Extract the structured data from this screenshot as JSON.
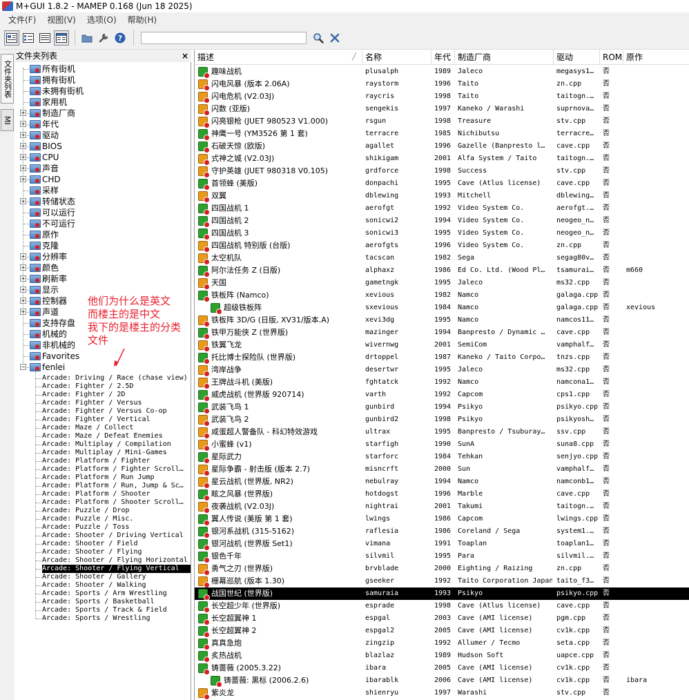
{
  "app": {
    "title": "M+GUI 1.8.2 - MAMEP 0.168 (Jun 18 2025)"
  },
  "menu": [
    "文件(F)",
    "视图(V)",
    "选项(O)",
    "帮助(H)"
  ],
  "search": {
    "value": "",
    "placeholder": ""
  },
  "vtabs": [
    "文件夹列表",
    "MI"
  ],
  "folder_panel": {
    "title": "文件夹列表",
    "close": "×"
  },
  "folders": [
    {
      "label": "所有街机",
      "exp": false
    },
    {
      "label": "拥有街机",
      "exp": false
    },
    {
      "label": "未拥有街机",
      "exp": false
    },
    {
      "label": "家用机",
      "exp": false
    },
    {
      "label": "制造厂商",
      "exp": true
    },
    {
      "label": "年代",
      "exp": true
    },
    {
      "label": "驱动",
      "exp": true
    },
    {
      "label": "BIOS",
      "exp": true
    },
    {
      "label": "CPU",
      "exp": true
    },
    {
      "label": "声音",
      "exp": true
    },
    {
      "label": "CHD",
      "exp": true
    },
    {
      "label": "采样",
      "exp": false
    },
    {
      "label": "转储状态",
      "exp": true
    },
    {
      "label": "可以运行",
      "exp": false
    },
    {
      "label": "不可运行",
      "exp": false
    },
    {
      "label": "原作",
      "exp": false
    },
    {
      "label": "克隆",
      "exp": false
    },
    {
      "label": "分辨率",
      "exp": true
    },
    {
      "label": "颜色",
      "exp": true
    },
    {
      "label": "刷新率",
      "exp": true
    },
    {
      "label": "显示",
      "exp": true
    },
    {
      "label": "控制器",
      "exp": true
    },
    {
      "label": "声道",
      "exp": true
    },
    {
      "label": "支持存盘",
      "exp": false
    },
    {
      "label": "机械的",
      "exp": false
    },
    {
      "label": "非机械的",
      "exp": false
    },
    {
      "label": "Favorites",
      "exp": false
    },
    {
      "label": "fenlei",
      "exp": "open"
    }
  ],
  "fenlei_items": [
    "Arcade: Driving / Race (chase view)",
    "Arcade: Fighter / 2.5D",
    "Arcade: Fighter / 2D",
    "Arcade: Fighter / Versus",
    "Arcade: Fighter / Versus Co-op",
    "Arcade: Fighter / Vertical",
    "Arcade: Maze / Collect",
    "Arcade: Maze / Defeat Enemies",
    "Arcade: Multiplay / Compilation",
    "Arcade: Multiplay / Mini-Games",
    "Arcade: Platform / Fighter",
    "Arcade: Platform / Fighter Scroll…",
    "Arcade: Platform / Run Jump",
    "Arcade: Platform / Run, Jump & Sc…",
    "Arcade: Platform / Shooter",
    "Arcade: Platform / Shooter Scroll…",
    "Arcade: Puzzle / Drop",
    "Arcade: Puzzle / Misc.",
    "Arcade: Puzzle / Toss",
    "Arcade: Shooter / Driving Vertical",
    "Arcade: Shooter / Field",
    "Arcade: Shooter / Flying",
    "Arcade: Shooter / Flying Horizontal",
    "Arcade: Shooter / Flying Vertical",
    "Arcade: Shooter / Gallery",
    "Arcade: Shooter / Walking",
    "Arcade: Sports / Arm Wrestling",
    "Arcade: Sports / Basketball",
    "Arcade: Sports / Track & Field",
    "Arcade: Sports / Wrestling"
  ],
  "selected_fenlei": 23,
  "annotation": [
    "他们为什么是英文",
    "而楼主的是中文",
    "我下的是楼主的分类",
    "文件"
  ],
  "columns": [
    "描述",
    "名称",
    "年代",
    "制造厂商",
    "驱动",
    "ROMs",
    "原作"
  ],
  "sort_indicator": "╱",
  "games": [
    {
      "d": "趣味战机",
      "n": "plusalph",
      "y": "1989",
      "m": "Jaleco",
      "dr": "megasys1…",
      "r": "否",
      "p": "",
      "i": "ok",
      "c": 0
    },
    {
      "d": "闪电风暴 (版本 2.06A)",
      "n": "raystorm",
      "y": "1996",
      "m": "Taito",
      "dr": "zn.cpp",
      "r": "否",
      "p": "",
      "i": "warn",
      "c": 0
    },
    {
      "d": "闪电危机 (V2.03J)",
      "n": "raycris",
      "y": "1998",
      "m": "Taito",
      "dr": "taitogn.…",
      "r": "否",
      "p": "",
      "i": "warn",
      "c": 0
    },
    {
      "d": "闪数 (亚版)",
      "n": "sengekis",
      "y": "1997",
      "m": "Kaneko / Warashi",
      "dr": "suprnova…",
      "r": "否",
      "p": "",
      "i": "warn",
      "c": 0
    },
    {
      "d": "闪亮银枪 (JUET 980523 V1.000)",
      "n": "rsgun",
      "y": "1998",
      "m": "Treasure",
      "dr": "stv.cpp",
      "r": "否",
      "p": "",
      "i": "warn",
      "c": 0
    },
    {
      "d": "神鹰一号 (YM3526 第 1 套)",
      "n": "terracre",
      "y": "1985",
      "m": "Nichibutsu",
      "dr": "terracre…",
      "r": "否",
      "p": "",
      "i": "ok",
      "c": 0
    },
    {
      "d": "石破天惊 (欧版)",
      "n": "agallet",
      "y": "1996",
      "m": "Gazelle (Banpresto l…",
      "dr": "cave.cpp",
      "r": "否",
      "p": "",
      "i": "ok",
      "c": 0
    },
    {
      "d": "式神之城 (V2.03J)",
      "n": "shikigam",
      "y": "2001",
      "m": "Alfa System / Taito",
      "dr": "taitogn.…",
      "r": "否",
      "p": "",
      "i": "warn",
      "c": 0
    },
    {
      "d": "守护英雄 (JUET 980318 V0.105)",
      "n": "grdforce",
      "y": "1998",
      "m": "Success",
      "dr": "stv.cpp",
      "r": "否",
      "p": "",
      "i": "warn",
      "c": 0
    },
    {
      "d": "首领蜂 (美版)",
      "n": "donpachi",
      "y": "1995",
      "m": "Cave (Atlus license)",
      "dr": "cave.cpp",
      "r": "否",
      "p": "",
      "i": "ok",
      "c": 0
    },
    {
      "d": "双翼",
      "n": "dblewing",
      "y": "1993",
      "m": "Mitchell",
      "dr": "dblewing…",
      "r": "否",
      "p": "",
      "i": "warn",
      "c": 0
    },
    {
      "d": "四国战机 1",
      "n": "aerofgt",
      "y": "1992",
      "m": "Video System Co.",
      "dr": "aerofgt.…",
      "r": "否",
      "p": "",
      "i": "ok",
      "c": 0
    },
    {
      "d": "四国战机 2",
      "n": "sonicwi2",
      "y": "1994",
      "m": "Video System Co.",
      "dr": "neogeo_n…",
      "r": "否",
      "p": "",
      "i": "ok",
      "c": 0
    },
    {
      "d": "四国战机 3",
      "n": "sonicwi3",
      "y": "1995",
      "m": "Video System Co.",
      "dr": "neogeo_n…",
      "r": "否",
      "p": "",
      "i": "ok",
      "c": 0
    },
    {
      "d": "四国战机 特别版 (台版)",
      "n": "aerofgts",
      "y": "1996",
      "m": "Video System Co.",
      "dr": "zn.cpp",
      "r": "否",
      "p": "",
      "i": "warn",
      "c": 0
    },
    {
      "d": "太空机队",
      "n": "tacscan",
      "y": "1982",
      "m": "Sega",
      "dr": "segag80v…",
      "r": "否",
      "p": "",
      "i": "warn",
      "c": 0
    },
    {
      "d": "阿尔法任务 Z (日版)",
      "n": "alphaxz",
      "y": "1986",
      "m": "Ed Co. Ltd. (Wood Pl…",
      "dr": "tsamurai…",
      "r": "否",
      "p": "m660",
      "i": "ok",
      "c": 0
    },
    {
      "d": "天国",
      "n": "gametngk",
      "y": "1995",
      "m": "Jaleco",
      "dr": "ms32.cpp",
      "r": "否",
      "p": "",
      "i": "warn",
      "c": 0
    },
    {
      "d": "铁板阵 (Namco)",
      "n": "xevious",
      "y": "1982",
      "m": "Namco",
      "dr": "galaga.cpp",
      "r": "否",
      "p": "",
      "i": "ok",
      "c": 0
    },
    {
      "d": "超级铁板阵",
      "n": "sxevious",
      "y": "1984",
      "m": "Namco",
      "dr": "galaga.cpp",
      "r": "否",
      "p": "xevious",
      "i": "ok",
      "c": 1
    },
    {
      "d": "铁板阵 3D/G (日版, XV31/版本.A)",
      "n": "xevi3dg",
      "y": "1995",
      "m": "Namco",
      "dr": "namcos11…",
      "r": "否",
      "p": "",
      "i": "warn",
      "c": 0
    },
    {
      "d": "铁甲万能侠 Z (世界版)",
      "n": "mazinger",
      "y": "1994",
      "m": "Banpresto / Dynamic …",
      "dr": "cave.cpp",
      "r": "否",
      "p": "",
      "i": "ok",
      "c": 0
    },
    {
      "d": "铁翼飞龙",
      "n": "wivernwg",
      "y": "2001",
      "m": "SemiCom",
      "dr": "vamphalf…",
      "r": "否",
      "p": "",
      "i": "warn",
      "c": 0
    },
    {
      "d": "托比博士探险队 (世界版)",
      "n": "drtoppel",
      "y": "1987",
      "m": "Kaneko / Taito Corpo…",
      "dr": "tnzs.cpp",
      "r": "否",
      "p": "",
      "i": "ok",
      "c": 0
    },
    {
      "d": "湾岸战争",
      "n": "desertwr",
      "y": "1995",
      "m": "Jaleco",
      "dr": "ms32.cpp",
      "r": "否",
      "p": "",
      "i": "warn",
      "c": 0
    },
    {
      "d": "王牌战斗机 (美版)",
      "n": "fghtatck",
      "y": "1992",
      "m": "Namco",
      "dr": "namcona1…",
      "r": "否",
      "p": "",
      "i": "warn",
      "c": 0
    },
    {
      "d": "威虎战机 (世界版 920714)",
      "n": "varth",
      "y": "1992",
      "m": "Capcom",
      "dr": "cps1.cpp",
      "r": "否",
      "p": "",
      "i": "ok",
      "c": 0
    },
    {
      "d": "武装飞鸟 1",
      "n": "gunbird",
      "y": "1994",
      "m": "Psikyo",
      "dr": "psikyo.cpp",
      "r": "否",
      "p": "",
      "i": "ok",
      "c": 0
    },
    {
      "d": "武装飞鸟 2",
      "n": "gunbird2",
      "y": "1998",
      "m": "Psikyo",
      "dr": "psikyosh…",
      "r": "否",
      "p": "",
      "i": "warn",
      "c": 0
    },
    {
      "d": "咸蛋超人警备队 - 科幻特效游戏",
      "n": "ultrax",
      "y": "1995",
      "m": "Banpresto / Tsuburay…",
      "dr": "ssv.cpp",
      "r": "否",
      "p": "",
      "i": "warn",
      "c": 0
    },
    {
      "d": "小蜜蜂 (v1)",
      "n": "starfigh",
      "y": "1990",
      "m": "SunA",
      "dr": "suna8.cpp",
      "r": "否",
      "p": "",
      "i": "warn",
      "c": 0
    },
    {
      "d": "星际武力",
      "n": "starforc",
      "y": "1984",
      "m": "Tehkan",
      "dr": "senjyo.cpp",
      "r": "否",
      "p": "",
      "i": "ok",
      "c": 0
    },
    {
      "d": "星际争霸 - 射击版 (版本 2.7)",
      "n": "misncrft",
      "y": "2000",
      "m": "Sun",
      "dr": "vamphalf…",
      "r": "否",
      "p": "",
      "i": "warn",
      "c": 0
    },
    {
      "d": "星云战机 (世界版, NR2)",
      "n": "nebulray",
      "y": "1994",
      "m": "Namco",
      "dr": "namconb1…",
      "r": "否",
      "p": "",
      "i": "warn",
      "c": 0
    },
    {
      "d": "眩之风暴 (世界版)",
      "n": "hotdogst",
      "y": "1996",
      "m": "Marble",
      "dr": "cave.cpp",
      "r": "否",
      "p": "",
      "i": "ok",
      "c": 0
    },
    {
      "d": "夜袭战机 (V2.03J)",
      "n": "nightrai",
      "y": "2001",
      "m": "Takumi",
      "dr": "taitogn.…",
      "r": "否",
      "p": "",
      "i": "warn",
      "c": 0
    },
    {
      "d": "翼人传说 (美版 第 1 套)",
      "n": "lwings",
      "y": "1986",
      "m": "Capcom",
      "dr": "lwings.cpp",
      "r": "否",
      "p": "",
      "i": "ok",
      "c": 0
    },
    {
      "d": "银河系战机 (315-5162)",
      "n": "raflesia",
      "y": "1986",
      "m": "Coreland / Sega",
      "dr": "system1.…",
      "r": "否",
      "p": "",
      "i": "ok",
      "c": 0
    },
    {
      "d": "银河战机 (世界版 Set1)",
      "n": "vimana",
      "y": "1991",
      "m": "Toaplan",
      "dr": "toaplan1…",
      "r": "否",
      "p": "",
      "i": "ok",
      "c": 0
    },
    {
      "d": "银色千年",
      "n": "silvmil",
      "y": "1995",
      "m": "Para",
      "dr": "silvmil.…",
      "r": "否",
      "p": "",
      "i": "ok",
      "c": 0
    },
    {
      "d": "勇气之刃 (世界版)",
      "n": "brvblade",
      "y": "2000",
      "m": "Eighting / Raizing",
      "dr": "zn.cpp",
      "r": "否",
      "p": "",
      "i": "warn",
      "c": 0
    },
    {
      "d": "栅幕巡航 (版本 1.30)",
      "n": "gseeker",
      "y": "1992",
      "m": "Taito Corporation Japan",
      "dr": "taito_f3…",
      "r": "否",
      "p": "",
      "i": "warn",
      "c": 0
    },
    {
      "d": "战国世纪 (世界版)",
      "n": "samuraia",
      "y": "1993",
      "m": "Psikyo",
      "dr": "psikyo.cpp",
      "r": "否",
      "p": "",
      "i": "ok",
      "c": 0,
      "sel": true
    },
    {
      "d": "长空超少年 (世界版)",
      "n": "esprade",
      "y": "1998",
      "m": "Cave (Atlus license)",
      "dr": "cave.cpp",
      "r": "否",
      "p": "",
      "i": "ok",
      "c": 0
    },
    {
      "d": "长空超翼神 1",
      "n": "espgal",
      "y": "2003",
      "m": "Cave (AMI license)",
      "dr": "pgm.cpp",
      "r": "否",
      "p": "",
      "i": "ok",
      "c": 0
    },
    {
      "d": "长空超翼神 2",
      "n": "espgal2",
      "y": "2005",
      "m": "Cave (AMI license)",
      "dr": "cv1k.cpp",
      "r": "否",
      "p": "",
      "i": "ok",
      "c": 0
    },
    {
      "d": "真真急炮",
      "n": "zingzip",
      "y": "1992",
      "m": "Allumer / Tecmo",
      "dr": "seta.cpp",
      "r": "否",
      "p": "",
      "i": "ok",
      "c": 0
    },
    {
      "d": "炙热战机",
      "n": "blazlaz",
      "y": "1989",
      "m": "Hudson Soft",
      "dr": "uapce.cpp",
      "r": "否",
      "p": "",
      "i": "ok",
      "c": 0
    },
    {
      "d": "铸蔷薇 (2005.3.22)",
      "n": "ibara",
      "y": "2005",
      "m": "Cave (AMI license)",
      "dr": "cv1k.cpp",
      "r": "否",
      "p": "",
      "i": "ok",
      "c": 0
    },
    {
      "d": "铸蔷薇: 黒标 (2006.2.6)",
      "n": "ibarablk",
      "y": "2006",
      "m": "Cave (AMI license)",
      "dr": "cv1k.cpp",
      "r": "否",
      "p": "ibara",
      "i": "ok",
      "c": 1
    },
    {
      "d": "紫炎龙",
      "n": "shienryu",
      "y": "1997",
      "m": "Warashi",
      "dr": "stv.cpp",
      "r": "否",
      "p": "",
      "i": "warn",
      "c": 0
    }
  ]
}
